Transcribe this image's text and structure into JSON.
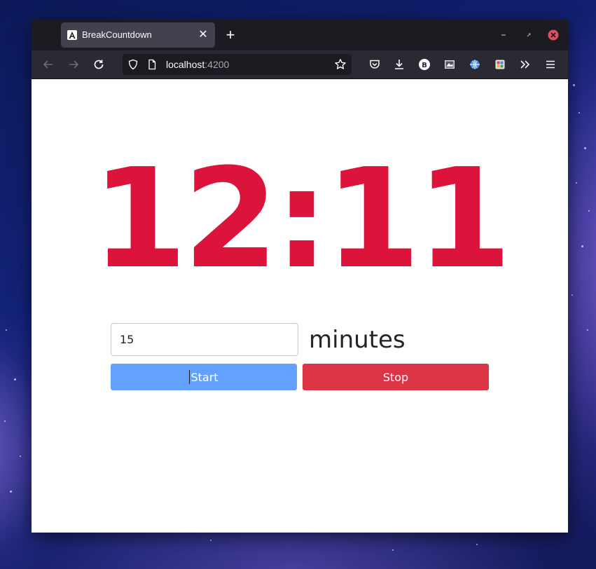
{
  "browser": {
    "tab_title": "BreakCountdown",
    "url_host": "localhost",
    "url_port": ":4200",
    "toolbar_icons": [
      "back-arrow-icon",
      "forward-arrow-icon",
      "reload-icon",
      "shield-icon",
      "page-icon",
      "bookmark-star-icon",
      "pocket-icon",
      "download-icon",
      "extension-b-icon",
      "extension-image-icon",
      "extension-globe-icon",
      "extension-grid-icon",
      "overflow-chevrons-icon",
      "hamburger-menu-icon"
    ],
    "extension_b_label": "B"
  },
  "app": {
    "countdown": "12:11",
    "minutes_value": "15",
    "minutes_label": "minutes",
    "start_label": "Start",
    "stop_label": "Stop"
  },
  "colors": {
    "countdown": "#dc143c",
    "start_button": "#62a1ff",
    "stop_button": "#dc3545",
    "window_close": "#e24c60"
  }
}
